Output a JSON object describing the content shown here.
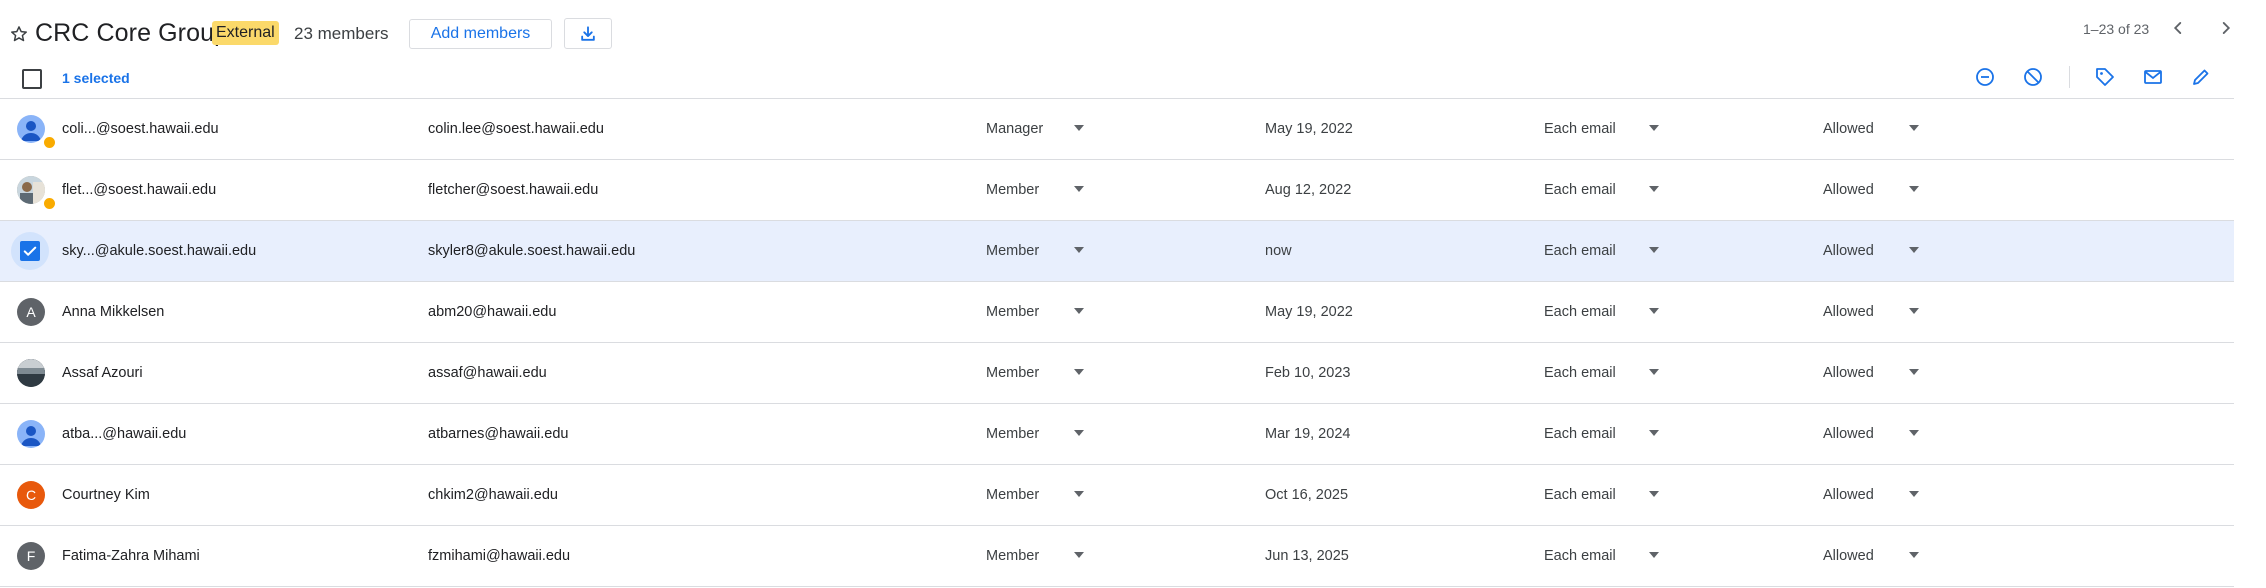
{
  "header": {
    "title": "CRC Core Group",
    "badge": "External",
    "member_count": "23 members",
    "add_members_label": "Add members",
    "pager": "1–23 of 23"
  },
  "toolbar": {
    "selected_label": "1 selected"
  },
  "colors": {
    "accent": "#1a73e8",
    "badge": "#fbd96a",
    "selected_row": "#e8effd"
  },
  "rows": [
    {
      "name": "coli...@soest.hawaii.edu",
      "email": "colin.lee@soest.hawaii.edu",
      "role": "Manager",
      "joined": "May 19, 2022",
      "subscription": "Each email",
      "posting": "Allowed",
      "avatar": "person-icon",
      "avatar_letter": "",
      "avatar_color": "#8ab4f8",
      "selected": false,
      "external": true
    },
    {
      "name": "flet...@soest.hawaii.edu",
      "email": "fletcher@soest.hawaii.edu",
      "role": "Member",
      "joined": "Aug 12, 2022",
      "subscription": "Each email",
      "posting": "Allowed",
      "avatar": "photo",
      "avatar_letter": "",
      "avatar_color": "#b5a48a",
      "selected": false,
      "external": true
    },
    {
      "name": "sky...@akule.soest.hawaii.edu",
      "email": "skyler8@akule.soest.hawaii.edu",
      "role": "Member",
      "joined": "now",
      "subscription": "Each email",
      "posting": "Allowed",
      "avatar": "checkbox",
      "avatar_letter": "",
      "avatar_color": "#1a73e8",
      "selected": true,
      "external": false
    },
    {
      "name": "Anna Mikkelsen",
      "email": "abm20@hawaii.edu",
      "role": "Member",
      "joined": "May 19, 2022",
      "subscription": "Each email",
      "posting": "Allowed",
      "avatar": "letter",
      "avatar_letter": "A",
      "avatar_color": "#5f6368",
      "selected": false,
      "external": false
    },
    {
      "name": "Assaf Azouri",
      "email": "assaf@hawaii.edu",
      "role": "Member",
      "joined": "Feb 10, 2023",
      "subscription": "Each email",
      "posting": "Allowed",
      "avatar": "photo-dark",
      "avatar_letter": "",
      "avatar_color": "#3c4a55",
      "selected": false,
      "external": false
    },
    {
      "name": "atba...@hawaii.edu",
      "email": "atbarnes@hawaii.edu",
      "role": "Member",
      "joined": "Mar 19, 2024",
      "subscription": "Each email",
      "posting": "Allowed",
      "avatar": "person-icon",
      "avatar_letter": "",
      "avatar_color": "#8ab4f8",
      "selected": false,
      "external": false
    },
    {
      "name": "Courtney Kim",
      "email": "chkim2@hawaii.edu",
      "role": "Member",
      "joined": "Oct 16, 2025",
      "subscription": "Each email",
      "posting": "Allowed",
      "avatar": "letter",
      "avatar_letter": "C",
      "avatar_color": "#e8590c",
      "selected": false,
      "external": false
    },
    {
      "name": "Fatima-Zahra Mihami",
      "email": "fzmihami@hawaii.edu",
      "role": "Member",
      "joined": "Jun 13, 2025",
      "subscription": "Each email",
      "posting": "Allowed",
      "avatar": "letter",
      "avatar_letter": "F",
      "avatar_color": "#5f6368",
      "selected": false,
      "external": false
    }
  ]
}
